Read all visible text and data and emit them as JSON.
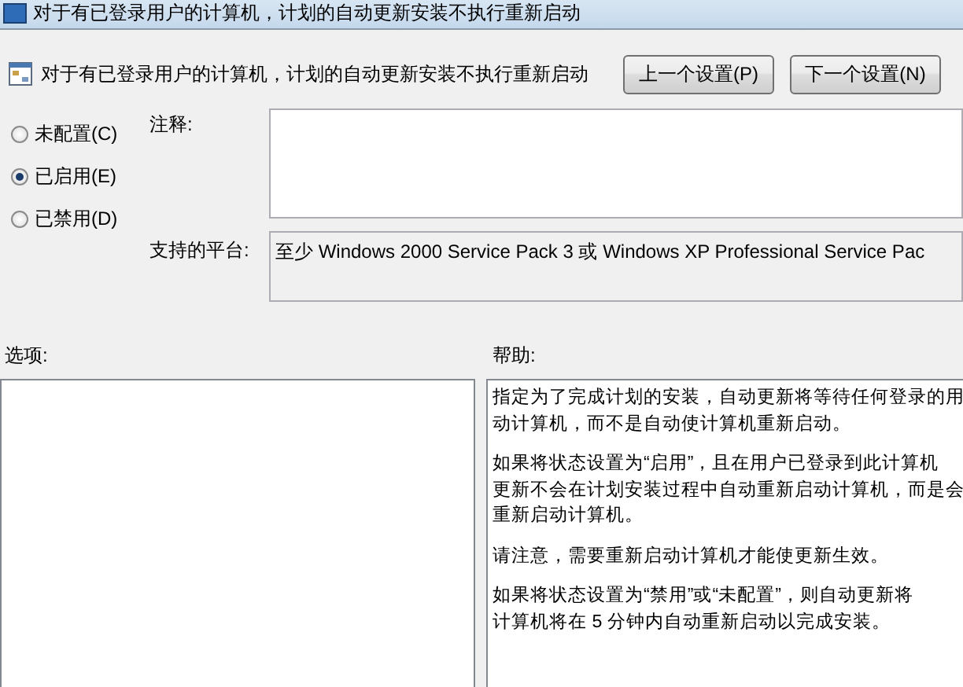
{
  "window": {
    "title": "对于有已登录用户的计算机，计划的自动更新安装不执行重新启动"
  },
  "header": {
    "setting_name": "对于有已登录用户的计算机，计划的自动更新安装不执行重新启动",
    "buttons": [
      {
        "label": "上一个设置(P)"
      },
      {
        "label": "下一个设置(N)"
      }
    ]
  },
  "states": [
    {
      "label": "未配置(C)",
      "selected": false
    },
    {
      "label": "已启用(E)",
      "selected": true
    },
    {
      "label": "已禁用(D)",
      "selected": false
    }
  ],
  "comment": {
    "label": "注释:"
  },
  "platform": {
    "label": "支持的平台:",
    "value": "至少 Windows 2000 Service Pack 3 或 Windows XP Professional Service Pac"
  },
  "options": {
    "label": "选项:"
  },
  "help": {
    "label": "帮助:",
    "paragraphs": [
      [
        "指定为了完成计划的安装，自动更新将等待任何登录的用",
        "动计算机，而不是自动使计算机重新启动。"
      ],
      [
        "如果将状态设置为“启用”，且在用户已登录到此计算机",
        "更新不会在计划安装过程中自动重新启动计算机，而是会",
        "重新启动计算机。"
      ],
      [
        "请注意，需要重新启动计算机才能使更新生效。"
      ],
      [
        "如果将状态设置为“禁用”或“未配置”，则自动更新将",
        "计算机将在 5 分钟内自动重新启动以完成安装。"
      ]
    ]
  }
}
